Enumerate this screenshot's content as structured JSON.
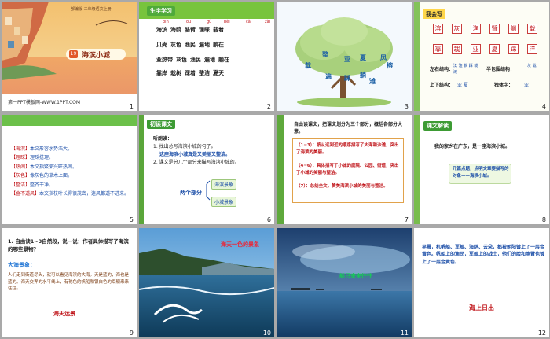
{
  "slides": {
    "s1": {
      "title": "海滨小城",
      "lesson_no": "19",
      "grade_line": "部编版·三年级语文上册",
      "footer": "第一PPT模板网-WWW.1PPT.COM",
      "num": "1"
    },
    "s2": {
      "tag": "生字学习",
      "num": "2",
      "rows": [
        {
          "pinyin": [
            "bīn",
            "ōu",
            "gǔ",
            "bèi",
            "cǎi",
            "zài"
          ],
          "words": [
            "海滨",
            "海鸥",
            "胳臂",
            "理睬",
            "载着",
            "贝壳"
          ]
        },
        {
          "pinyin": [],
          "words": [
            "灰色",
            "渔民",
            "遍地",
            "躺在",
            "更加"
          ]
        },
        {
          "pinyin": [],
          "words": [
            "亚热带",
            "灰色",
            "渔民",
            "遍地",
            "躺在"
          ]
        },
        {
          "pinyin": [],
          "words": [
            "靠岸",
            "栽树",
            "踩着",
            "整洁",
            "夏天"
          ]
        }
      ]
    },
    "s3": {
      "num": "3",
      "leaves": [
        "凤",
        "榕",
        "夏",
        "亚",
        "整",
        "载",
        "遍",
        "踩",
        "躺",
        "滩"
      ]
    },
    "s4": {
      "tag": "我会写",
      "num": "4",
      "chars": [
        "滨",
        "灰",
        "渔",
        "臂",
        "躺",
        "载",
        "靠",
        "栽",
        "亚",
        "夏",
        "踩",
        "洋"
      ],
      "left_label": "左右结构：",
      "left_value": "滨 渔 躺 踩 栽 滩",
      "half_label": "半包围结构：",
      "half_value": "灰 载",
      "top_label": "上下结构：",
      "top_value": "亚 夏",
      "single_label": "独体字：",
      "single_value": "亚"
    },
    "s5": {
      "num": "5",
      "items": [
        {
          "term": "【海滨】",
          "def": "本文形容水势浩大。"
        },
        {
          "term": "【理睬】",
          "def": "理睬搭理。"
        },
        {
          "term": "【热闹】",
          "def": "本文指繁荣兴旺热闹。"
        },
        {
          "term": "【灰色】",
          "def": "像灰色的草木上面。"
        },
        {
          "term": "【整洁】",
          "def": "整齐干净。"
        },
        {
          "term": "【金不透风】",
          "def": "本文指枝叶长得很茂密，连风都透不进来。"
        }
      ]
    },
    "s6": {
      "tag": "初读课文",
      "num": "6",
      "intro": "听朗读：",
      "q1": "1. 找出总写海滨小城的句子。",
      "a1": "这座海滨小城真是又美丽又整洁。",
      "q2": "2. 课文是分几个部分来描写海滨小城的。",
      "left": "两个部分",
      "top_box": "海滨景象",
      "bottom_box": "小城景象"
    },
    "s7": {
      "num": "7",
      "head": "自由读课文，把课文划分为三个部分，概括各部分大意。",
      "p1": "（1~3）：按从远到近的顺序描写了大海和沙滩，突出了海滨的美丽。",
      "p2": "（4~6）：具体描写了小城的庭院、公园、街道，突出了小城的美丽与整洁。",
      "p3": "（7）：总结全文，赞美海滨小城的美丽与整洁。"
    },
    "s8": {
      "tag": "课文解读",
      "num": "8",
      "quote": "我的家乡在广东，是一座海滨小城。",
      "note": "开篇点题，点明文章要描写的对象——海滨小城。"
    },
    "s9": {
      "num": "9",
      "q": "1. 自由读1~3自然段，说一说：作者具体描写了海滨的哪些景物？",
      "sub": "大海景象：",
      "body": "人们走到街道尽头，就可以看见海滨的大海。天是蓝的，海也是蓝的。海天交界的水平线上，有艳色的帆船和银白色的军舰来来往往。",
      "foot": "海天远景"
    },
    "s10": {
      "num": "10",
      "caption": "海天一色的景象"
    },
    "s11": {
      "num": "11",
      "caption": "船只来来往往"
    },
    "s12": {
      "num": "12",
      "body": "早晨，机帆船、军舰、海鸥、云朵，都被朝阳镀上了一层金黄色。帆船上的渔民，军舰上的战士，他们的脸和胳臂也镀上了一层金黄色。",
      "foot": "海上日出"
    }
  },
  "colors": {
    "red": "#c0161b",
    "blue": "#1d4fa8",
    "green": "#78c43d"
  }
}
